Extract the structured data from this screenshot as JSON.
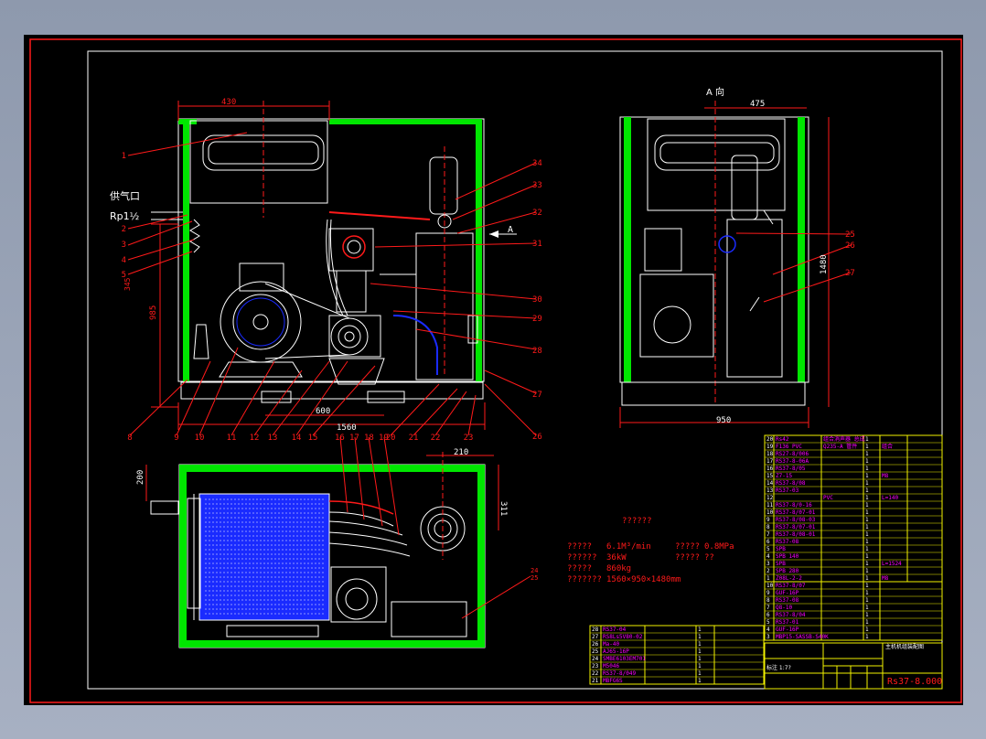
{
  "colors": {
    "background": "#000000",
    "frame": "#ffffff",
    "red": "#ff1a1a",
    "green": "#00e600",
    "blue": "#1a2bff",
    "magenta": "#ff00ff",
    "yellow": "#f2f200",
    "white": "#ffffff"
  },
  "front_view": {
    "dims": {
      "top_width": "430",
      "height": "985",
      "inner_width": "600",
      "bottom_width": "1560",
      "left_small": "345"
    },
    "labels": {
      "air_outlet": "供气口",
      "thread": "Rp1½"
    },
    "left_callouts": [
      "1",
      "2",
      "3",
      "4",
      "5"
    ],
    "right_callouts": [
      "34",
      "33",
      "32",
      "31",
      "30",
      "29",
      "28",
      "27",
      "26"
    ],
    "bottom_callouts": [
      "8",
      "9",
      "10",
      "11",
      "12",
      "13",
      "14",
      "15",
      "20",
      "21",
      "22",
      "23"
    ],
    "arrow_label": "A"
  },
  "side_view": {
    "title": "A 向",
    "dims": {
      "top_width": "475",
      "height": "1480",
      "bottom_width": "950"
    },
    "callouts": [
      "25",
      "26",
      "27"
    ]
  },
  "top_view": {
    "dims": {
      "w": "210",
      "h": "311",
      "left": "200"
    },
    "callouts": [
      "16",
      "17",
      "18",
      "19"
    ],
    "side_callouts": [
      "24",
      "25"
    ]
  },
  "specs": {
    "heading": "??????",
    "rows": [
      {
        "label": "?????",
        "value": "6.1M³/min",
        "label2": "?????",
        "value2": "0.8MPa"
      },
      {
        "label": "??????",
        "value": "36kW",
        "label2": "?????",
        "value2": "??"
      },
      {
        "label": "?????",
        "value": "860kg",
        "label2": "",
        "value2": ""
      },
      {
        "label": "???????",
        "value": "1560×950×1480mm",
        "label2": "",
        "value2": ""
      }
    ]
  },
  "bom_upper": [
    {
      "no": "20",
      "code": "Rs42",
      "name": "组合消声器 总成",
      "qty": "1",
      "mat": ""
    },
    {
      "no": "19",
      "code": "F136 PVC",
      "name": "Q235-A 管件",
      "qty": "1",
      "mat": "组合"
    },
    {
      "no": "18",
      "code": "RS27-8/006",
      "name": "",
      "qty": "1",
      "mat": ""
    },
    {
      "no": "17",
      "code": "RS37-8-06A",
      "name": "",
      "qty": "1",
      "mat": ""
    },
    {
      "no": "16",
      "code": "RS37-8/05",
      "name": "",
      "qty": "1",
      "mat": ""
    },
    {
      "no": "15",
      "code": "Z7-15",
      "name": "",
      "qty": "1",
      "mat": "M8"
    },
    {
      "no": "14",
      "code": "RS37-8/08",
      "name": "",
      "qty": "1",
      "mat": ""
    },
    {
      "no": "13",
      "code": "RS37-03",
      "name": "",
      "qty": "1",
      "mat": ""
    },
    {
      "no": "12",
      "code": "",
      "name": "PVC",
      "qty": "1",
      "mat": "L=140"
    },
    {
      "no": "11",
      "code": "RS37-8/0-16",
      "name": "",
      "qty": "1",
      "mat": ""
    },
    {
      "no": "10",
      "code": "RS37-8/07-01",
      "name": "",
      "qty": "1",
      "mat": ""
    },
    {
      "no": "9",
      "code": "RS37-8/08-03",
      "name": "",
      "qty": "1",
      "mat": ""
    },
    {
      "no": "8",
      "code": "RS37-8/07-01",
      "name": "",
      "qty": "1",
      "mat": ""
    },
    {
      "no": "7",
      "code": "RS37-8/08-01",
      "name": "",
      "qty": "1",
      "mat": ""
    },
    {
      "no": "6",
      "code": "RS37-08",
      "name": "",
      "qty": "1",
      "mat": ""
    },
    {
      "no": "5",
      "code": "SPB",
      "name": "",
      "qty": "1",
      "mat": ""
    },
    {
      "no": "4",
      "code": "SPB 140",
      "name": "",
      "qty": "1",
      "mat": ""
    },
    {
      "no": "3",
      "code": "SPB",
      "name": "",
      "qty": "1",
      "mat": "L=1524"
    },
    {
      "no": "2",
      "code": "SPB 280",
      "name": "",
      "qty": "1",
      "mat": ""
    },
    {
      "no": "1",
      "code": "Z08L-2-2",
      "name": "",
      "qty": "1",
      "mat": "M8"
    }
  ],
  "bom_lower_right": [
    {
      "no": "10",
      "code": "RS37-8/07",
      "name": "",
      "qty": "1"
    },
    {
      "no": "9",
      "code": "GUF-16P",
      "name": "",
      "qty": "1"
    },
    {
      "no": "8",
      "code": "RS37-08",
      "name": "",
      "qty": "1"
    },
    {
      "no": "7",
      "code": "Q8-10",
      "name": "",
      "qty": "1"
    },
    {
      "no": "6",
      "code": "RS37-8/04",
      "name": "",
      "qty": "1"
    },
    {
      "no": "5",
      "code": "RS37-01",
      "name": "",
      "qty": "1"
    },
    {
      "no": "4",
      "code": "GUF-16P",
      "name": "",
      "qty": "1"
    },
    {
      "no": "3",
      "code": "MBP15-SASSB-S40K",
      "name": "",
      "qty": "1"
    }
  ],
  "bom_lower_left": [
    {
      "no": "28",
      "code": "RS37-04",
      "name": "",
      "qty": "1"
    },
    {
      "no": "27",
      "code": "RS8Ls5V80-02",
      "name": "",
      "qty": "1"
    },
    {
      "no": "26",
      "code": "Ma-40",
      "name": "",
      "qty": "1"
    },
    {
      "no": "25",
      "code": "AJ65-16P",
      "name": "",
      "qty": "1"
    },
    {
      "no": "24",
      "code": "SMBE6103EM701",
      "name": "",
      "qty": "1"
    },
    {
      "no": "23",
      "code": "M5046",
      "name": "",
      "qty": "1"
    },
    {
      "no": "22",
      "code": "RS37-8/049",
      "name": "",
      "qty": "1"
    },
    {
      "no": "21",
      "code": "MBFG6S",
      "name": "",
      "qty": "1"
    }
  ],
  "title_block": {
    "company": "主机机组装配图",
    "drawing_no": "Rs37-8.000",
    "scale_label": "标注 1:7?"
  }
}
